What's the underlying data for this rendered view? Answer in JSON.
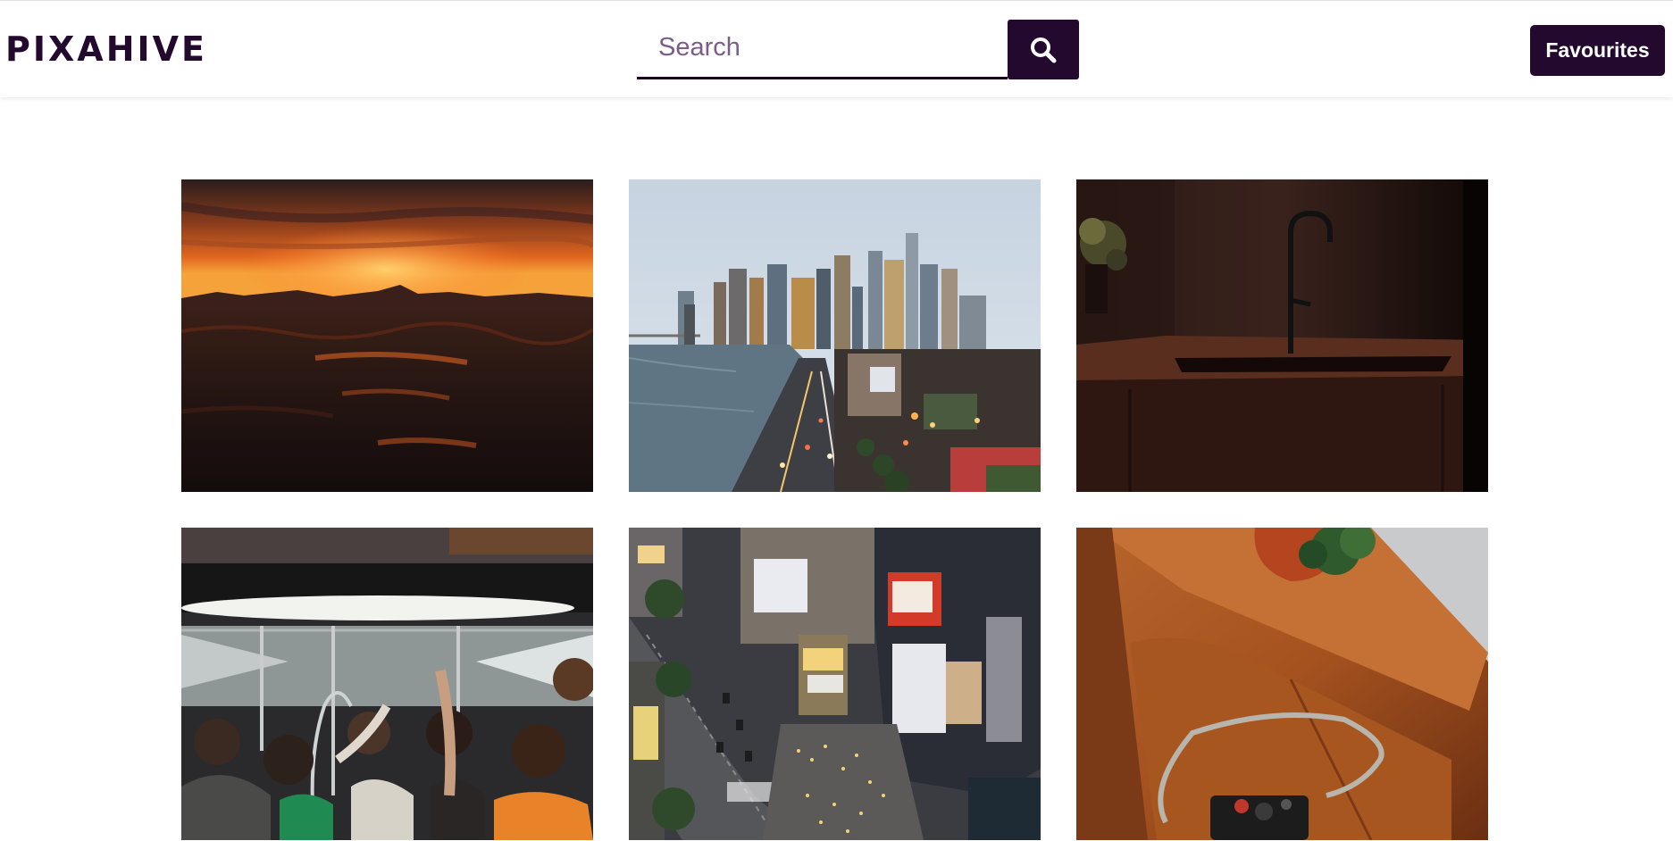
{
  "header": {
    "logo": "PIXAHIVE",
    "search_placeholder": "Search",
    "search_value": "",
    "search_icon": "search-icon",
    "favourites_label": "Favourites"
  },
  "colors": {
    "brand": "#24092f",
    "background": "#ffffff"
  },
  "gallery": {
    "images": [
      {
        "subject": "sunset-over-sea"
      },
      {
        "subject": "city-skyline-bridge-highway-dusk"
      },
      {
        "subject": "dark-kitchen-sink-faucet"
      },
      {
        "subject": "crowded-subway-car"
      },
      {
        "subject": "aerial-city-crossing-night"
      },
      {
        "subject": "camera-on-leather-armchair"
      }
    ]
  }
}
